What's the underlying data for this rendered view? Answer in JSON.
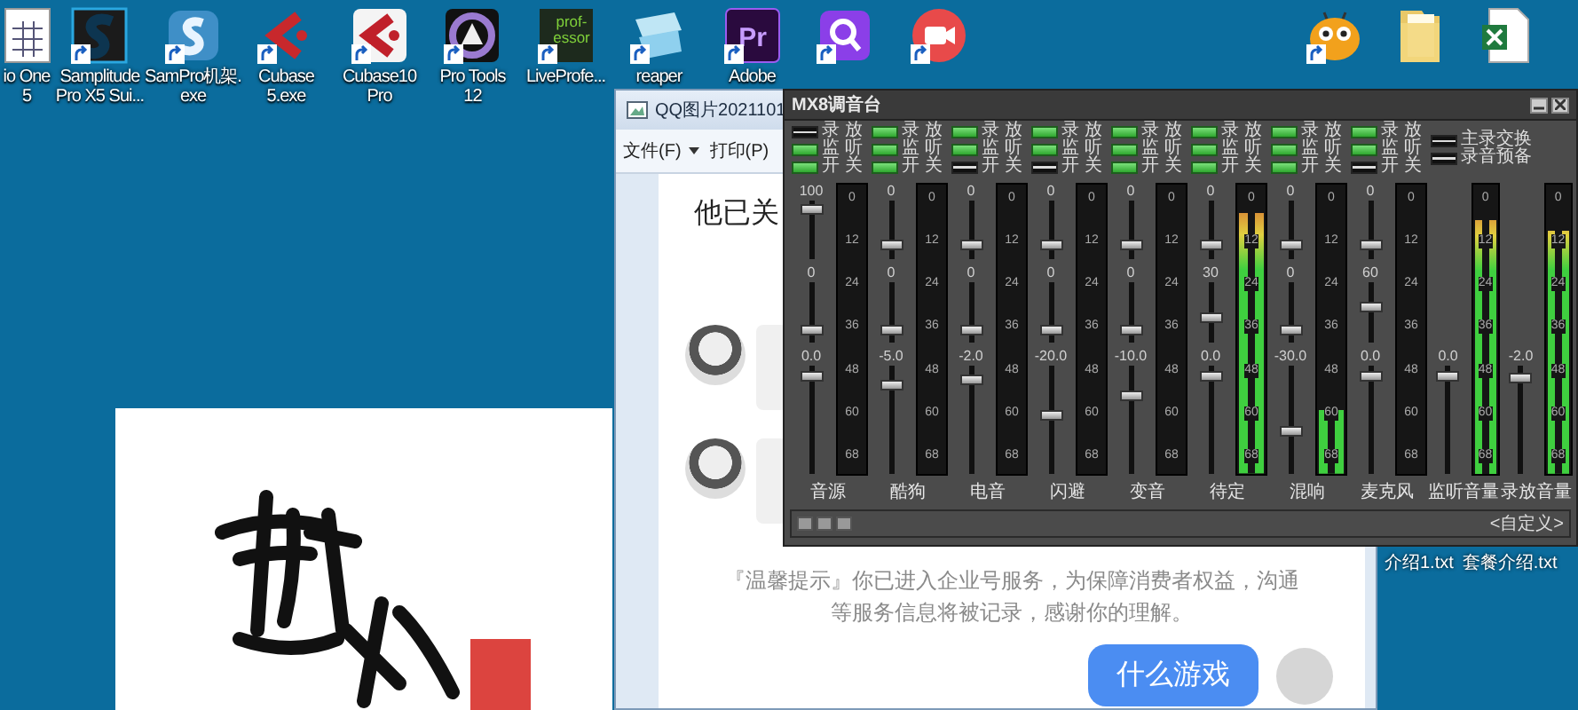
{
  "desktop_icons": [
    {
      "kind": "document",
      "shortcut": false,
      "label_lines": [
        "io One",
        "5"
      ]
    },
    {
      "kind": "samplitude",
      "shortcut": true,
      "label_lines": [
        "Samplitude",
        "Pro X5 Sui..."
      ]
    },
    {
      "kind": "sampro",
      "shortcut": true,
      "label_lines": [
        "SamPro机架.",
        "exe"
      ]
    },
    {
      "kind": "cubase",
      "shortcut": true,
      "label_lines": [
        "Cubase",
        "5.exe"
      ]
    },
    {
      "kind": "cubase10",
      "shortcut": true,
      "label_lines": [
        "Cubase10",
        "Pro"
      ]
    },
    {
      "kind": "protools",
      "shortcut": true,
      "label_lines": [
        "Pro Tools",
        "12"
      ]
    },
    {
      "kind": "liveprofessor",
      "shortcut": true,
      "icon_text": [
        "prof-",
        "essor"
      ],
      "label_lines": [
        "LiveProfe..."
      ]
    },
    {
      "kind": "reaper",
      "shortcut": true,
      "label_lines": [
        "reaper"
      ]
    },
    {
      "kind": "premiere",
      "shortcut": true,
      "icon_text": [
        "Pr"
      ],
      "label_lines": [
        "Adobe"
      ]
    },
    {
      "kind": "search-app",
      "shortcut": true
    },
    {
      "kind": "camera-app",
      "shortcut": true
    }
  ],
  "desktop_icons_right": [
    {
      "kind": "mascot",
      "shortcut": true
    },
    {
      "kind": "folder",
      "shortcut": false
    },
    {
      "kind": "spreadsheet",
      "shortcut": false
    }
  ],
  "desktop_files": [
    "介绍1.txt",
    "套餐介绍.txt"
  ],
  "viewer": {
    "title": "QQ图片2021101",
    "menu": [
      {
        "label": "文件(F)",
        "dropdown": true
      },
      {
        "label": "打印(P)",
        "dropdown": false
      }
    ],
    "chat": {
      "heading": "他已关",
      "messages": [
        {
          "kind": "incoming"
        },
        {
          "kind": "incoming"
        },
        {
          "kind": "notice",
          "lines": [
            "『温馨提示』你已进入企业号服务，为保障消费者权益，沟通",
            "等服务信息将被记录，感谢你的理解。"
          ]
        },
        {
          "kind": "outgoing",
          "text": "什么游戏"
        }
      ]
    }
  },
  "mixer": {
    "title": "MX8调音台",
    "channels": [
      {
        "name": "音源",
        "toggles": [
          {
            "label": "录 放",
            "on": false
          },
          {
            "label": "监 听",
            "on": true
          },
          {
            "label": "开 关",
            "on": true
          }
        ],
        "faders": [
          {
            "value": "100",
            "level": 0.92
          },
          {
            "value": "0",
            "level": 0.15
          },
          {
            "value": "0.0",
            "level": 0.95
          }
        ],
        "meter": {
          "level": 0,
          "scale": [
            "0",
            "12",
            "24",
            "36",
            "48",
            "60",
            "68"
          ]
        }
      },
      {
        "name": "酷狗",
        "toggles": [
          {
            "label": "录 放",
            "on": true
          },
          {
            "label": "监 听",
            "on": true
          },
          {
            "label": "开 关",
            "on": true
          }
        ],
        "faders": [
          {
            "value": "0",
            "level": 0.2
          },
          {
            "value": "0",
            "level": 0.15
          },
          {
            "value": "-5.0",
            "level": 0.85
          }
        ],
        "meter": {
          "level": 0,
          "scale": [
            "0",
            "12",
            "24",
            "36",
            "48",
            "60",
            "68"
          ]
        }
      },
      {
        "name": "电音",
        "toggles": [
          {
            "label": "录 放",
            "on": true
          },
          {
            "label": "监 听",
            "on": true
          },
          {
            "label": "开 关",
            "on": false
          }
        ],
        "faders": [
          {
            "value": "0",
            "level": 0.2
          },
          {
            "value": "0",
            "level": 0.15
          },
          {
            "value": "-2.0",
            "level": 0.9
          }
        ],
        "meter": {
          "level": 0,
          "scale": [
            "0",
            "12",
            "24",
            "36",
            "48",
            "60",
            "68"
          ]
        }
      },
      {
        "name": "闪避",
        "toggles": [
          {
            "label": "录 放",
            "on": true
          },
          {
            "label": "监 听",
            "on": true
          },
          {
            "label": "开 关",
            "on": false
          }
        ],
        "faders": [
          {
            "value": "0",
            "level": 0.2
          },
          {
            "value": "0",
            "level": 0.15
          },
          {
            "value": "-20.0",
            "level": 0.55
          }
        ],
        "meter": {
          "level": 0,
          "scale": [
            "0",
            "12",
            "24",
            "36",
            "48",
            "60",
            "68"
          ]
        }
      },
      {
        "name": "变音",
        "toggles": [
          {
            "label": "录 放",
            "on": true
          },
          {
            "label": "监 听",
            "on": true
          },
          {
            "label": "开 关",
            "on": true
          }
        ],
        "faders": [
          {
            "value": "0",
            "level": 0.2
          },
          {
            "value": "0",
            "level": 0.15
          },
          {
            "value": "-10.0",
            "level": 0.75
          }
        ],
        "meter": {
          "level": 0,
          "scale": [
            "0",
            "12",
            "24",
            "36",
            "48",
            "60",
            "68"
          ]
        }
      },
      {
        "name": "待定",
        "toggles": [
          {
            "label": "录 放",
            "on": true
          },
          {
            "label": "监 听",
            "on": true
          },
          {
            "label": "开 关",
            "on": true
          }
        ],
        "faders": [
          {
            "value": "0",
            "level": 0.2
          },
          {
            "value": "30",
            "level": 0.4
          },
          {
            "value": "0.0",
            "level": 0.95
          }
        ],
        "meter": {
          "level": 0.9,
          "scale": [
            "0",
            "12",
            "24",
            "36",
            "48",
            "60",
            "68"
          ]
        }
      },
      {
        "name": "混响",
        "toggles": [
          {
            "label": "录 放",
            "on": true
          },
          {
            "label": "监 听",
            "on": true
          },
          {
            "label": "开 关",
            "on": true
          }
        ],
        "faders": [
          {
            "value": "0",
            "level": 0.2
          },
          {
            "value": "0",
            "level": 0.15
          },
          {
            "value": "-30.0",
            "level": 0.38
          }
        ],
        "meter": {
          "level": 0.22,
          "scale": [
            "0",
            "12",
            "24",
            "36",
            "48",
            "60",
            "68"
          ]
        }
      },
      {
        "name": "麦克风",
        "toggles": [
          {
            "label": "录 放",
            "on": true
          },
          {
            "label": "监 听",
            "on": true
          },
          {
            "label": "开 关",
            "on": false
          }
        ],
        "faders": [
          {
            "value": "0",
            "level": 0.2
          },
          {
            "value": "60",
            "level": 0.6
          },
          {
            "value": "0.0",
            "level": 0.95
          }
        ],
        "meter": {
          "level": 0,
          "scale": [
            "0",
            "12",
            "24",
            "36",
            "48",
            "60",
            "68"
          ]
        }
      }
    ],
    "switches": [
      {
        "label": "主录交换",
        "on": false
      },
      {
        "label": "录音预备",
        "on": false
      }
    ],
    "monitors": [
      {
        "name": "监听音量",
        "fader": {
          "value": "0.0",
          "level": 0.95
        },
        "meter": {
          "level": 0.88,
          "scale": [
            "0",
            "12",
            "24",
            "36",
            "48",
            "60",
            "68"
          ]
        }
      },
      {
        "name": "录放音量",
        "fader": {
          "value": "-2.0",
          "level": 0.93
        },
        "meter": {
          "level": 0.84,
          "scale": [
            "0",
            "12",
            "24",
            "36",
            "48",
            "60",
            "68"
          ]
        }
      }
    ],
    "footer_label": "<自定义>"
  }
}
